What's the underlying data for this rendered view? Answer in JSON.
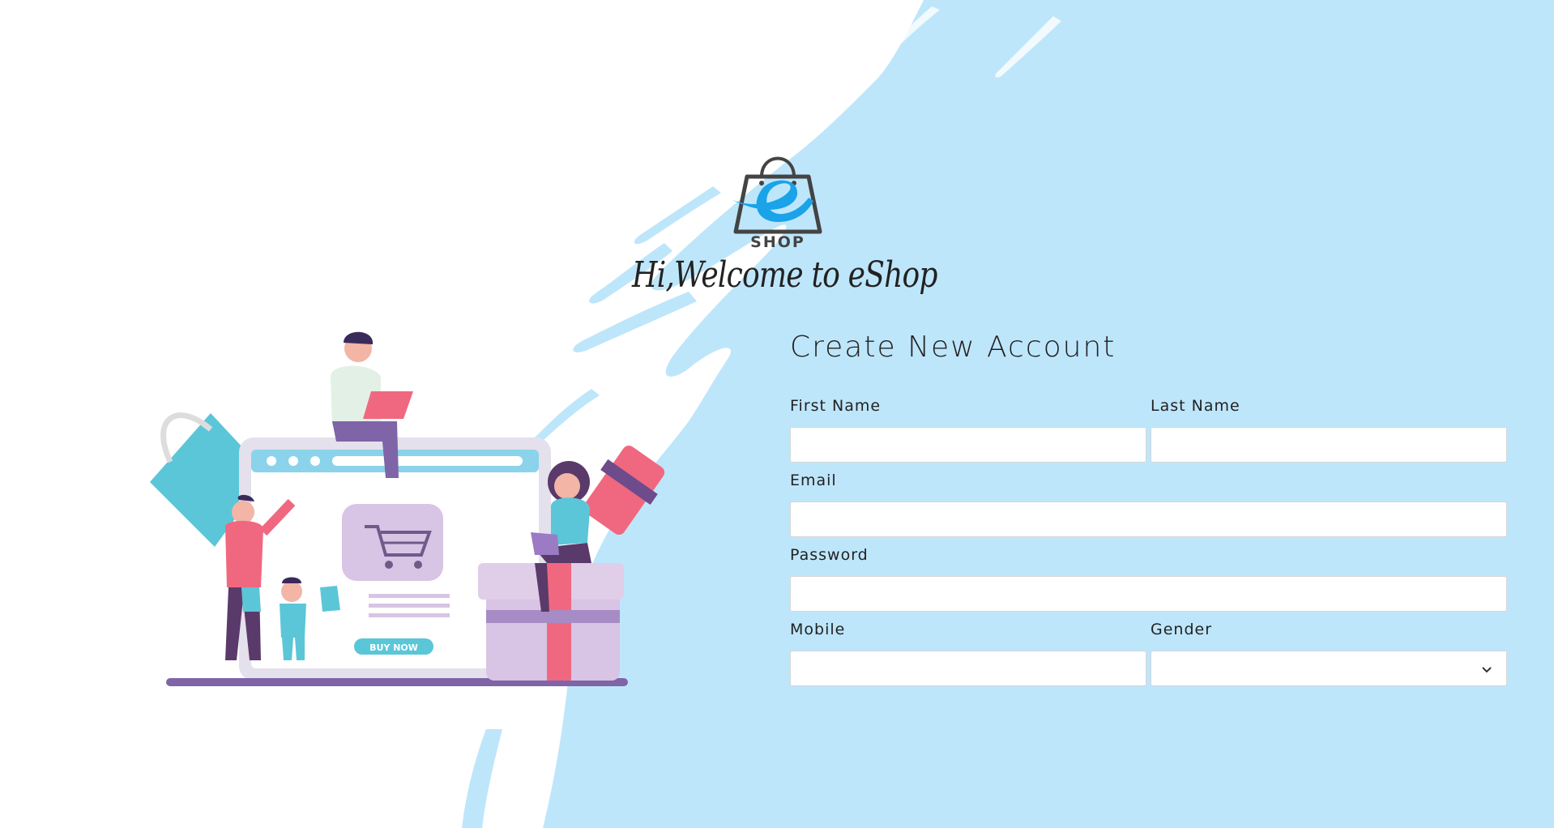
{
  "brand": {
    "logo_text": "SHOP",
    "welcome": "Hi,Welcome to eShop",
    "accent_blue": "#1aa3e8",
    "bg_blue": "#bee6fb"
  },
  "illustration": {
    "buy_now": "BUY NOW"
  },
  "form": {
    "title": "Create New Account",
    "first_name": {
      "label": "First Name",
      "value": "",
      "placeholder": ""
    },
    "last_name": {
      "label": "Last Name",
      "value": "",
      "placeholder": ""
    },
    "email": {
      "label": "Email",
      "value": "",
      "placeholder": ""
    },
    "password": {
      "label": "Password",
      "value": "",
      "placeholder": ""
    },
    "mobile": {
      "label": "Mobile",
      "value": "",
      "placeholder": ""
    },
    "gender": {
      "label": "Gender",
      "selected": ""
    }
  }
}
